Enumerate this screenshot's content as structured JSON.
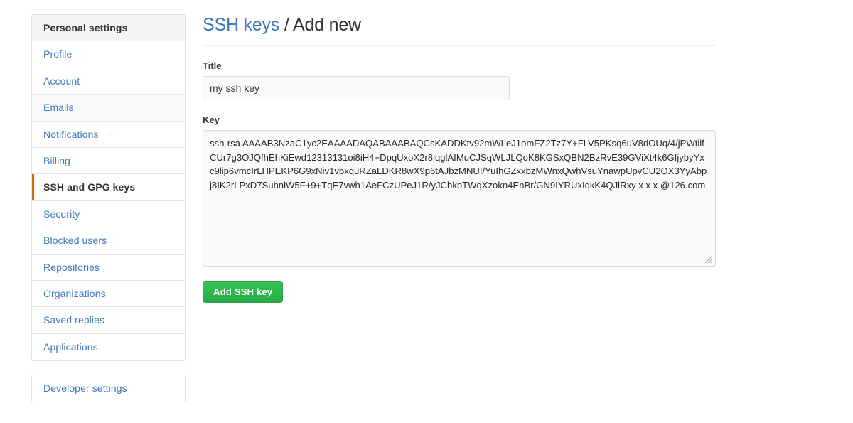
{
  "sidebar": {
    "groups": [
      {
        "name": "personal-settings-group",
        "items": [
          {
            "label": "Personal settings",
            "kind": "header"
          },
          {
            "label": "Profile",
            "kind": "link"
          },
          {
            "label": "Account",
            "kind": "link"
          },
          {
            "label": "Emails",
            "kind": "link-tinted"
          },
          {
            "label": "Notifications",
            "kind": "link"
          },
          {
            "label": "Billing",
            "kind": "link"
          },
          {
            "label": "SSH and GPG keys",
            "kind": "selected"
          },
          {
            "label": "Security",
            "kind": "link"
          },
          {
            "label": "Blocked users",
            "kind": "link"
          },
          {
            "label": "Repositories",
            "kind": "link"
          },
          {
            "label": "Organizations",
            "kind": "link"
          },
          {
            "label": "Saved replies",
            "kind": "link"
          },
          {
            "label": "Applications",
            "kind": "link"
          }
        ]
      },
      {
        "name": "developer-settings-group",
        "items": [
          {
            "label": "Developer settings",
            "kind": "link"
          }
        ]
      }
    ]
  },
  "main": {
    "heading": {
      "link_label": "SSH keys",
      "separator": " / ",
      "current": "Add new"
    },
    "title_field": {
      "label": "Title",
      "value": "my ssh key",
      "placeholder": ""
    },
    "key_field": {
      "label": "Key",
      "value": "ssh-rsa AAAAB3NzaC1yc2EAAAADAQABAAABAQCsKADDKtv92mWLeJ1omFZ2Tz7Y+FLV5PKsq6uV8dOUq/4/jPWtiifCUr7g3OJQfhEhKiEwd12313131oi8iH4+DpqUxoX2r8lqglAIMuCJSqWLJLQoK8KGSxQBN2BzRvE39GViXt4k6GIjybyYxc9lip6vmcIrLHPEKP6G9xNiv1vbxquRZaLDKR8wX9p6tAJbzMNUI/YuIhGZxxbzMWnxQwhVsuYnawpUpvCU2OX3YyAbpj8IK2rLPxD7SuhnlW5F+9+TqE7vwh1AeFCzUPeJ1R/yJCbkbTWqXzokn4EnBr/GN9IYRUxIqkK4QJlRxy x x x @126.com",
      "placeholder": ""
    },
    "submit_button": {
      "label": "Add SSH key"
    }
  },
  "colors": {
    "link": "#4078c0",
    "selected_marker": "#d26911",
    "button_green": "#27a844",
    "text": "#333333",
    "border": "#e0e0e0"
  }
}
